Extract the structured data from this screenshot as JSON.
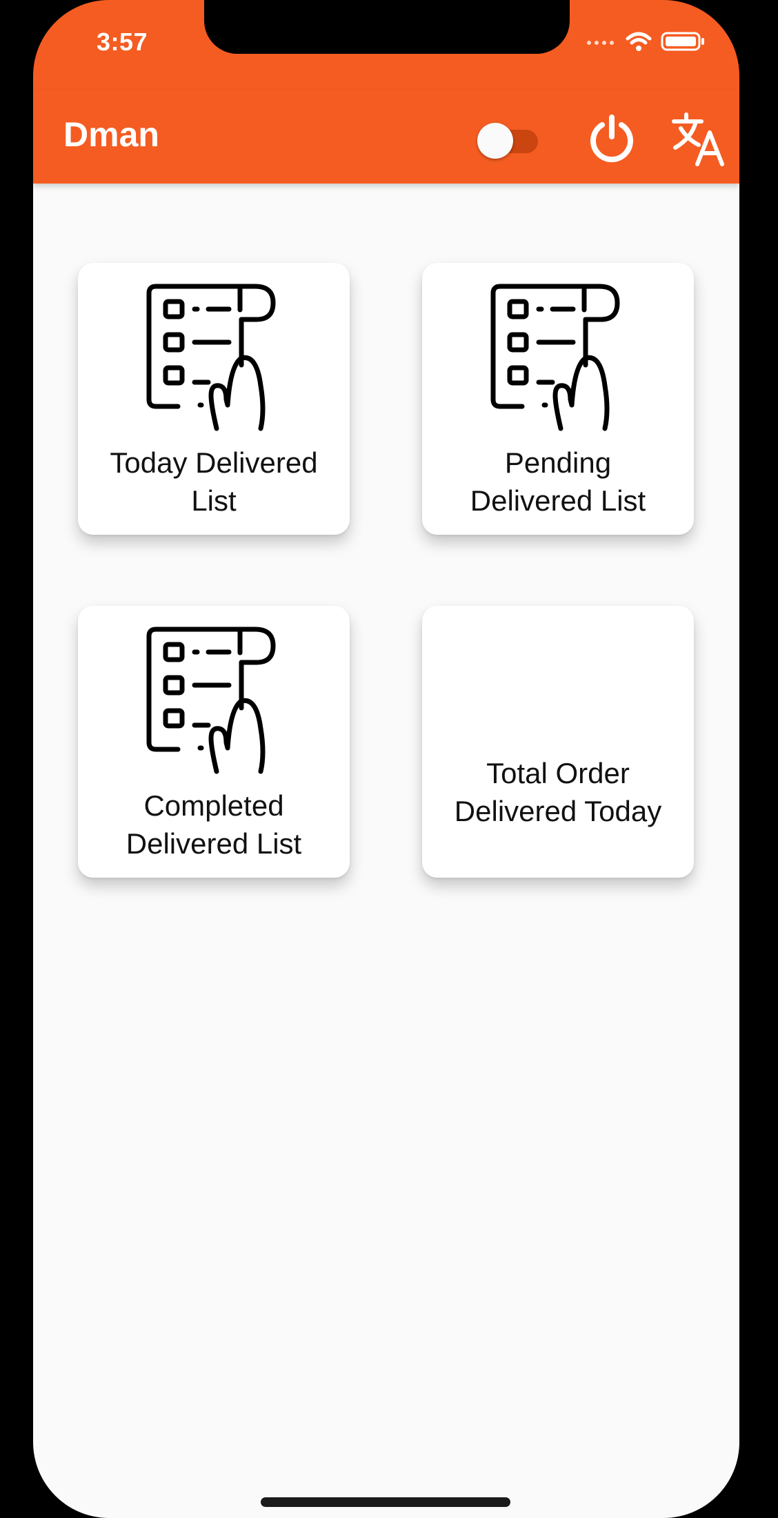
{
  "status_bar": {
    "time": "3:57"
  },
  "app_bar": {
    "title": "Dman",
    "toggle_state": "off"
  },
  "cards": [
    {
      "line1": "Today Delivered",
      "line2": "List",
      "icon": "receipt-list-hand-icon"
    },
    {
      "line1": "Pending",
      "line2": "Delivered List",
      "icon": "receipt-list-hand-icon"
    },
    {
      "line1": "Completed",
      "line2": "Delivered List",
      "icon": "receipt-list-hand-icon"
    },
    {
      "line1": "Total Order",
      "line2": "Delivered Today",
      "icon": ""
    }
  ],
  "colors": {
    "primary": "#f55c22",
    "background": "#fafafa",
    "card": "#ffffff"
  }
}
